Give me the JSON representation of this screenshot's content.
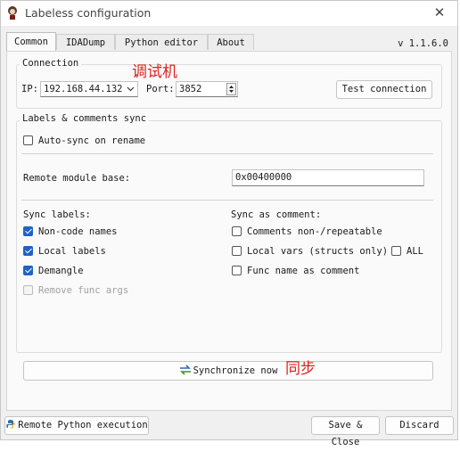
{
  "window": {
    "title": "Labeless configuration",
    "close_glyph": "✕",
    "version": "v 1.1.6.0"
  },
  "tabs": [
    {
      "label": "Common",
      "active": true
    },
    {
      "label": "IDADump",
      "active": false
    },
    {
      "label": "Python editor",
      "active": false
    },
    {
      "label": "About",
      "active": false
    }
  ],
  "connection": {
    "title": "Connection",
    "annotation": "调试机",
    "ip_label": "IP:",
    "ip_value": "192.168.44.132",
    "port_label": "Port:",
    "port_value": "3852",
    "test_button": "Test connection"
  },
  "labels_sync": {
    "title": "Labels & comments sync",
    "auto_sync": {
      "label": "Auto-sync on rename",
      "checked": false
    },
    "remote_base_label": "Remote module base:",
    "remote_base_value": "0x00400000",
    "sync_labels_title": "Sync labels:",
    "sync_labels": {
      "non_code_names": {
        "label": "Non-code names",
        "checked": true
      },
      "local_labels": {
        "label": "Local labels",
        "checked": true
      },
      "demangle": {
        "label": "Demangle",
        "checked": true
      },
      "remove_func_args": {
        "label": "Remove func args",
        "checked": false,
        "disabled": true
      }
    },
    "sync_as_comment_title": "Sync as comment:",
    "sync_as_comment": {
      "comments_non_repeatable": {
        "label": "Comments non-/repeatable",
        "checked": false
      },
      "local_vars": {
        "label": "Local vars (structs only)",
        "checked": false
      },
      "all": {
        "label": "ALL",
        "checked": false
      },
      "func_name": {
        "label": "Func name as comment",
        "checked": false
      }
    }
  },
  "sync_button": "Synchronize now",
  "sync_annotation": "同步",
  "footer": {
    "remote_python": "Remote Python execution",
    "save_close": "Save & Close",
    "discard": "Discard"
  },
  "icons": {
    "app": "labeless-logo-icon",
    "sync": "sync-arrows-icon",
    "python": "python-icon"
  },
  "colors": {
    "checkbox_checked": "#1f63c4",
    "annotation": "#e02020"
  }
}
